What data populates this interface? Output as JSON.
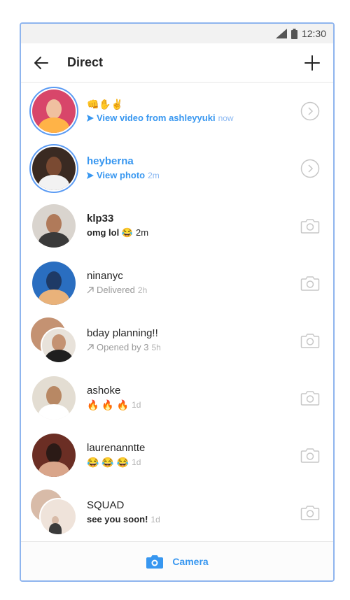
{
  "status_bar": {
    "time": "12:30"
  },
  "header": {
    "title": "Direct"
  },
  "threads": [
    {
      "name": "👊✋✌",
      "preview": "View video from ashleyyuki",
      "time": "now",
      "style": "unseen",
      "avatar_colors": [
        "#d8466a",
        "#f0c0a0",
        "#ffb347"
      ]
    },
    {
      "name": "heyberna",
      "preview": "View photo",
      "time": "2m",
      "style": "unseen",
      "avatar_colors": [
        "#3a2a22",
        "#7a4a32",
        "#f2f2f2"
      ]
    },
    {
      "name": "klp33",
      "preview": "omg lol 😂",
      "time": "2m",
      "style": "bold",
      "avatar_colors": [
        "#d9d4ce",
        "#b07a5a",
        "#3a3a3a"
      ]
    },
    {
      "name": "ninanyc",
      "preview": "Delivered",
      "time": "2h",
      "style": "delivered",
      "avatar_colors": [
        "#2a6ec0",
        "#1e3a66",
        "#e9b27a"
      ]
    },
    {
      "name": "bday planning!!",
      "preview": "Opened by 3",
      "time": "5h",
      "style": "opened",
      "avatar_colors": [
        "#e8e2da",
        "#c49272",
        "#1f1f1f"
      ]
    },
    {
      "name": "ashoke",
      "preview": "🔥 🔥 🔥",
      "time": "1d",
      "style": "emoji",
      "avatar_colors": [
        "#e3ddd2",
        "#b88864",
        "#ffffff"
      ]
    },
    {
      "name": "laurenanntte",
      "preview": "😂 😂 😂",
      "time": "1d",
      "style": "emoji",
      "avatar_colors": [
        "#6b2e24",
        "#2b1a16",
        "#d9a58a"
      ]
    },
    {
      "name": "SQUAD",
      "preview": "see you soon!",
      "time": "1d",
      "style": "bold-preview",
      "avatar_colors": [
        "#efe3da",
        "#d8bba8",
        "#3b3b3b"
      ]
    }
  ],
  "bottom_bar": {
    "label": "Camera"
  },
  "colors": {
    "accent": "#3897f0",
    "ring": "#5b9bf3",
    "frame": "#8fb5ee"
  },
  "icons": {
    "back": "arrow-left-icon",
    "new": "plus-icon",
    "open": "chevron-circle-icon",
    "camera": "camera-icon"
  }
}
